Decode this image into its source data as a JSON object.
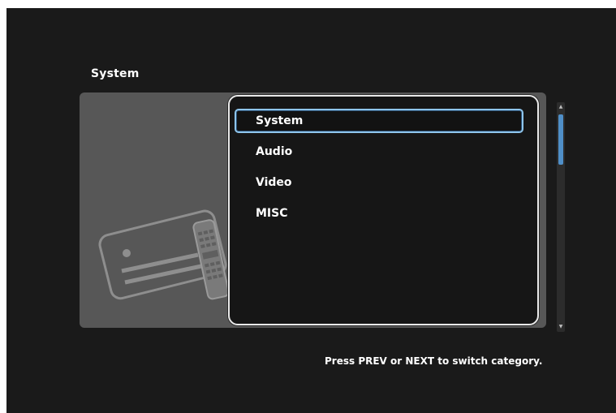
{
  "header": {
    "title": "System"
  },
  "menu": {
    "items": [
      {
        "label": "System",
        "selected": true
      },
      {
        "label": "Audio",
        "selected": false
      },
      {
        "label": "Video",
        "selected": false
      },
      {
        "label": "MISC",
        "selected": false
      }
    ]
  },
  "scrollbar": {
    "up_icon": "up-arrow-icon",
    "down_icon": "down-arrow-icon"
  },
  "illustration": {
    "icon": "card-remote-icon"
  },
  "footer": {
    "hint": "Press PREV or NEXT to switch category."
  },
  "colors": {
    "background": "#1a1a1a",
    "panel": "#575757",
    "selection_border": "#8ec5ec",
    "scroll_thumb": "#4f8fc8",
    "text": "#ffffff"
  }
}
